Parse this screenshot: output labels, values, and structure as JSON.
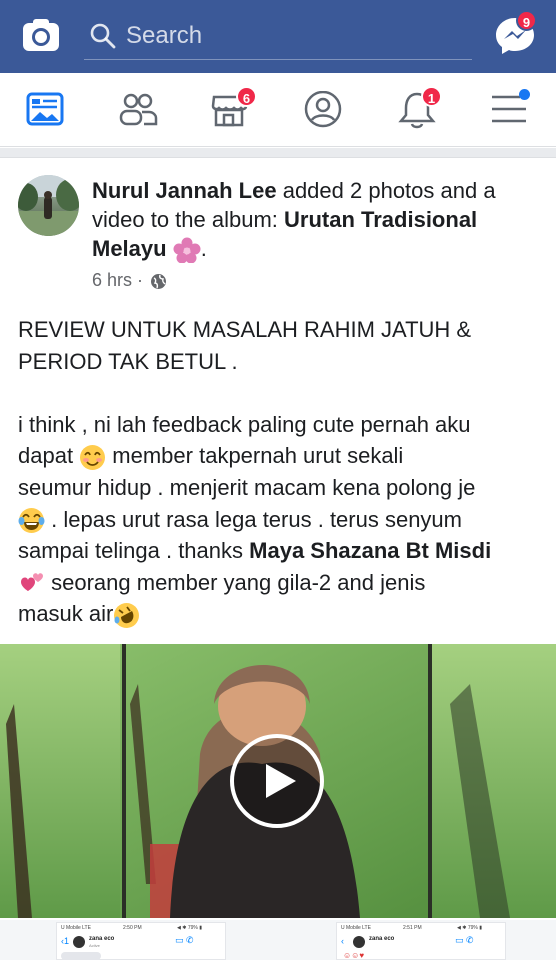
{
  "topbar": {
    "search_placeholder": "Search",
    "messenger_badge": "9",
    "accent": "#3b5998"
  },
  "navbar": {
    "marketplace_badge": "6",
    "notifications_badge": "1",
    "items": [
      "news-feed-icon",
      "friends-icon",
      "marketplace-icon",
      "profile-icon",
      "notifications-icon",
      "menu-icon"
    ]
  },
  "post": {
    "author": "Nurul Jannah Lee",
    "action": " added 2 photos and a video to the album: ",
    "album": "Urutan Tradisional Melayu",
    "period": ".",
    "time": "6 hrs",
    "separator": " · ",
    "text_lines": [
      "REVIEW UNTUK MASALAH RAHIM JATUH &",
      "PERIOD TAK BETUL .",
      "i think , ni lah feedback paling cute pernah aku",
      "member takpernah urut sekali",
      "seumur hidup . menjerit macam kena polong je",
      ". lepas urut rasa lega terus  . terus senyum",
      "sampai telinga . thanks ",
      "seorang member yang gila-2 and jenis",
      "masuk air"
    ],
    "line4_prefix": "dapat ",
    "mention": "Maya Shazana Bt Misdi"
  },
  "thumbnails": [
    {
      "carrier": "U Mobile  LTE",
      "time": "2:50 PM",
      "battery": "◀ ✱ 79% ▮",
      "name": "zana eco",
      "sub": "Active"
    },
    {
      "carrier": "U Mobile  LTE",
      "time": "2:51 PM",
      "battery": "◀ ✱ 79% ▮",
      "name": "zana eco",
      "sub": ""
    }
  ]
}
